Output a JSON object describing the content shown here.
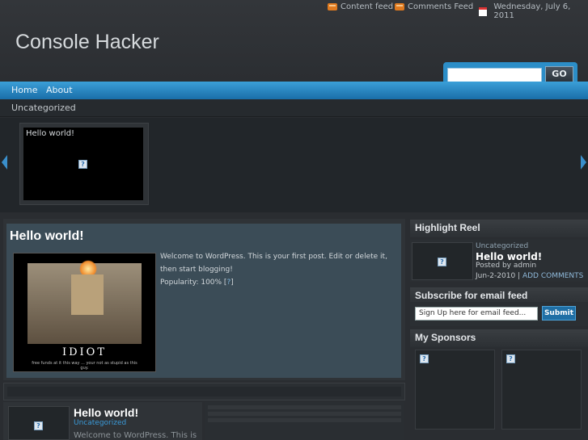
{
  "topbar": {
    "content_feed": "Content feed",
    "comments_feed": "Comments Feed",
    "date": "Wednesday, July 6, 2011"
  },
  "site": {
    "title": "Console Hacker"
  },
  "search": {
    "button": "GO",
    "value": ""
  },
  "nav": {
    "items": [
      "Home",
      "About"
    ]
  },
  "subnav": {
    "items": [
      "Uncategorized"
    ]
  },
  "featured": {
    "slide_title": "Hello world!"
  },
  "post": {
    "title": "Hello world!",
    "image_caption": "IDIOT",
    "image_subcaption": "free funds at it this way ... your not as stupid as this guy.",
    "text": "Welcome to WordPress. This is your first post. Edit or delete it, then start blogging!",
    "popularity_label": "Popularity: 100% [",
    "popularity_link": "?",
    "popularity_end": "]"
  },
  "post2": {
    "title": "Hello world!",
    "category": "Uncategorized",
    "text": "Welcome to WordPress. This is"
  },
  "sidebar": {
    "highlight_heading": "Highlight Reel",
    "highlight": {
      "category": "Uncategorized",
      "title": "Hello world!",
      "posted_by": "Posted by admin",
      "date": "Jun-2-2010",
      "sep": " | ",
      "comments": "ADD COMMENTS"
    },
    "subscribe_heading": "Subscribe for email feed",
    "subscribe_placeholder": "Sign Up here for email feed...",
    "subscribe_button": "Submit",
    "sponsors_heading": "My Sponsors"
  },
  "colors": {
    "accent": "#2c8ec8",
    "nav": "#1a6ea8",
    "post_bg": "#3b4c57"
  },
  "icons": [
    "rss-icon",
    "calendar-icon",
    "arrow-left-icon",
    "arrow-right-icon",
    "broken-image-icon"
  ]
}
